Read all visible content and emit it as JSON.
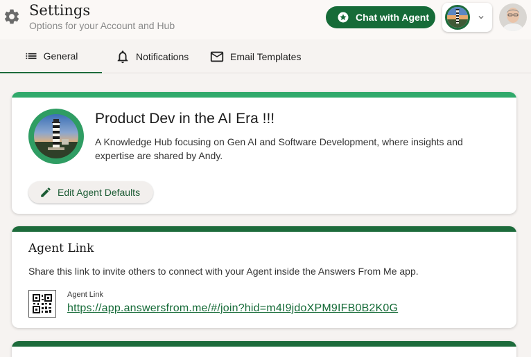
{
  "header": {
    "title": "Settings",
    "subtitle": "Options for your Account and Hub",
    "chat_button_label": "Chat with Agent"
  },
  "tabs": [
    {
      "label": "General",
      "icon": "list-icon",
      "active": true
    },
    {
      "label": "Notifications",
      "icon": "bell-icon",
      "active": false
    },
    {
      "label": "Email Templates",
      "icon": "mail-icon",
      "active": false
    }
  ],
  "hub": {
    "name": "Product Dev in the AI Era !!!",
    "description": "A Knowledge Hub focusing on Gen AI and Software Development, where insights and expertise are shared by Andy.",
    "edit_button_label": "Edit Agent Defaults"
  },
  "agent_link": {
    "title": "Agent Link",
    "description": "Share this link to invite others to connect with your Agent inside the Answers From Me app.",
    "field_label": "Agent Link",
    "url": "https://app.answersfrom.me/#/join?hid=m4I9jdoXPM9IFB0B2K0G"
  },
  "colors": {
    "brand_green": "#166b38",
    "accent_green": "#30a96b",
    "background": "#f6f3f1"
  }
}
